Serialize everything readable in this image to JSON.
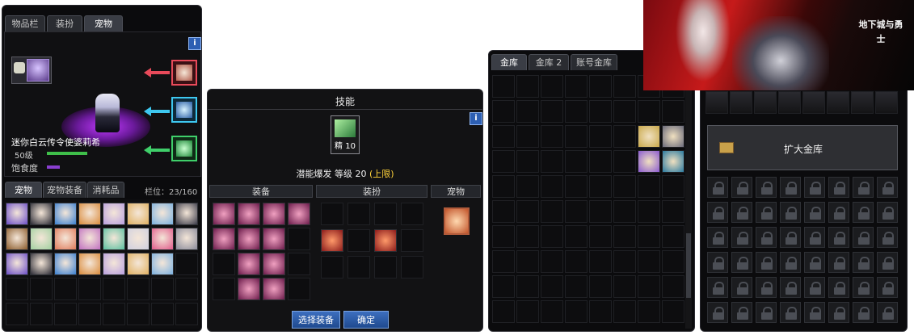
{
  "panel1": {
    "tabs": [
      "物品栏",
      "装扮",
      "宠物"
    ],
    "active_tab": "宠物",
    "info_label": "i",
    "pet_name": "迷你白云传令使婆莉希",
    "level": "50级",
    "satiety_label": "饱食度",
    "bottom_tabs": [
      "宠物",
      "宠物装备",
      "消耗品"
    ],
    "capacity": "栏位：23/160",
    "colors": {
      "arrow_red": "#e84a5a",
      "arrow_blue": "#3ec8f0",
      "arrow_green": "#3fcf6a",
      "level_bar": "#3fbf4a",
      "satiety_bar": "#8a3fd1"
    }
  },
  "panel2": {
    "title": "技能",
    "info_label": "i",
    "skill_badge": "精 10",
    "skill_line": "潜能爆发 等级 20",
    "skill_limit": "(上限)",
    "sections": [
      "装备",
      "装扮",
      "宠物"
    ],
    "buttons": {
      "select_equip": "选择装备",
      "confirm": "确定"
    },
    "colors": {
      "limit_text": "#ffd23a"
    }
  },
  "panel3": {
    "tabs": [
      "金库 1",
      "金库 2",
      "账号金库"
    ]
  },
  "panel4": {
    "expand_button": "扩大金库",
    "banner_logo": "地下城与勇士"
  }
}
